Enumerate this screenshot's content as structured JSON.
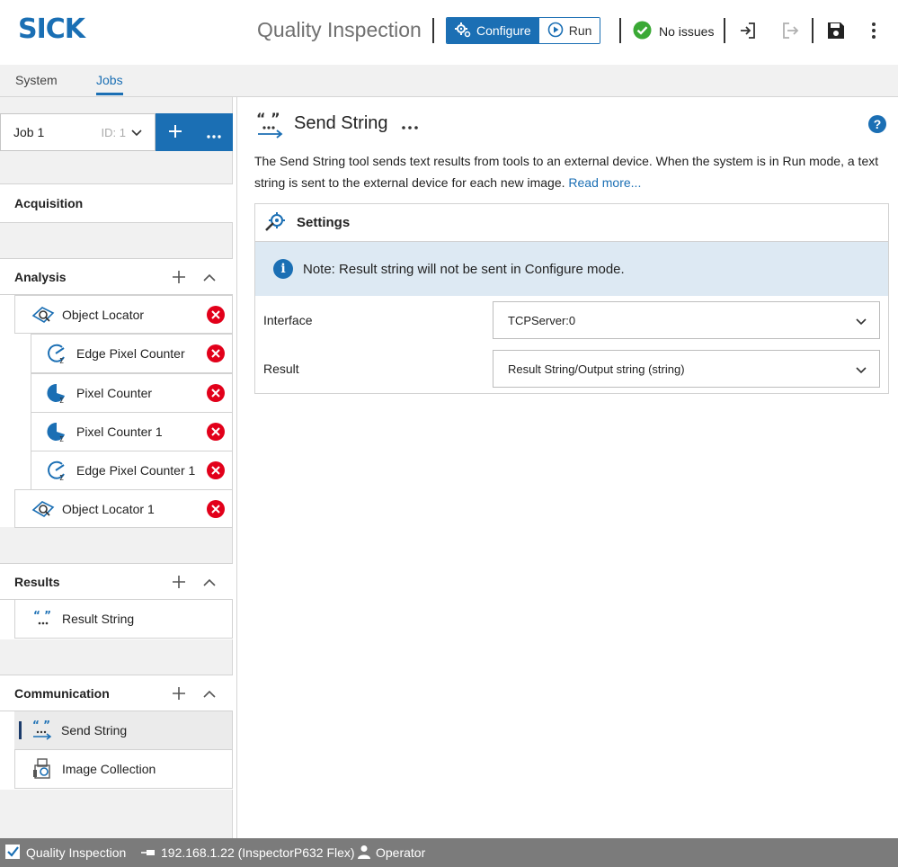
{
  "header": {
    "logo": "SICK",
    "app_title": "Quality Inspection",
    "mode_configure": "Configure",
    "mode_run": "Run",
    "status_text": "No issues",
    "colors": {
      "accent": "#1b6fb4",
      "ok": "#3aa935",
      "error": "#e2001a"
    }
  },
  "tabs": [
    {
      "label": "System"
    },
    {
      "label": "Jobs"
    }
  ],
  "sidebar": {
    "job": {
      "name": "Job 1",
      "id_label": "ID: 1"
    },
    "sections": {
      "acquisition": "Acquisition",
      "analysis": "Analysis",
      "results": "Results",
      "communication": "Communication"
    },
    "analysis_items": [
      {
        "label": "Object Locator",
        "icon": "object-locator-icon"
      },
      {
        "label": "Edge Pixel Counter",
        "icon": "edge-pixel-counter-icon"
      },
      {
        "label": "Pixel Counter",
        "icon": "pixel-counter-icon"
      },
      {
        "label": "Pixel Counter 1",
        "icon": "pixel-counter-icon"
      },
      {
        "label": "Edge Pixel Counter 1",
        "icon": "edge-pixel-counter-icon"
      },
      {
        "label": "Object Locator 1",
        "icon": "object-locator-icon"
      }
    ],
    "results_items": [
      {
        "label": "Result String",
        "icon": "result-string-icon"
      }
    ],
    "communication_items": [
      {
        "label": "Send String",
        "icon": "send-string-icon",
        "selected": true
      },
      {
        "label": "Image Collection",
        "icon": "image-collection-icon"
      }
    ]
  },
  "main": {
    "title": "Send String",
    "description": "The Send String tool sends text results from tools to an external device. When the system is in Run mode, a text string is sent to the external device for each new image.",
    "read_more": "Read more...",
    "settings": {
      "title": "Settings",
      "note": "Note: Result string will not be sent in Configure mode.",
      "interface_label": "Interface",
      "interface_value": "TCPServer:0",
      "result_label": "Result",
      "result_value": "Result String/Output string (string)"
    }
  },
  "footer": {
    "app": "Quality Inspection",
    "device": "192.168.1.22 (InspectorP632 Flex)",
    "user": "Operator"
  }
}
